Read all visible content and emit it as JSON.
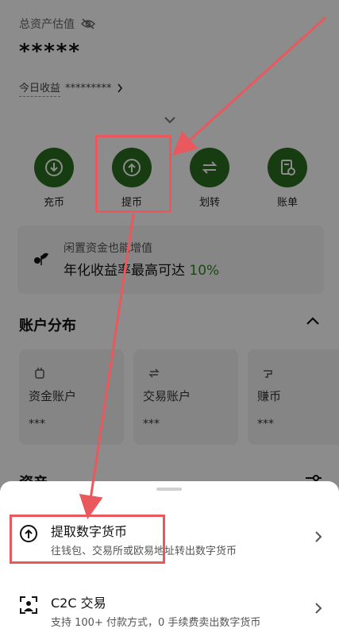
{
  "header": {
    "total_label": "总资产估值",
    "total_value": "*****",
    "today_label": "今日收益",
    "today_value": "*********"
  },
  "actions": [
    {
      "label": "充币",
      "icon": "download-icon"
    },
    {
      "label": "提币",
      "icon": "upload-icon"
    },
    {
      "label": "划转",
      "icon": "transfer-icon"
    },
    {
      "label": "账单",
      "icon": "bill-icon"
    }
  ],
  "promo": {
    "line1": "闲置资金也能增值",
    "line2": "年化收益率最高可达",
    "pct": "10%"
  },
  "distribution": {
    "title": "账户分布",
    "accounts": [
      {
        "name": "资金账户",
        "value": "***"
      },
      {
        "name": "交易账户",
        "value": "***"
      },
      {
        "name": "赚币",
        "value": "***"
      }
    ]
  },
  "assets": {
    "title": "资产"
  },
  "sheet": {
    "options": [
      {
        "title": "提取数字货币",
        "sub": "往钱包、交易所或欧易地址转出数字货币"
      },
      {
        "title": "C2C 交易",
        "sub": "支持 100+ 付款方式，0 手续费卖出数字货币"
      }
    ]
  },
  "colors": {
    "accent_green": "#2c6e1f",
    "highlight_red": "#e8585c"
  }
}
